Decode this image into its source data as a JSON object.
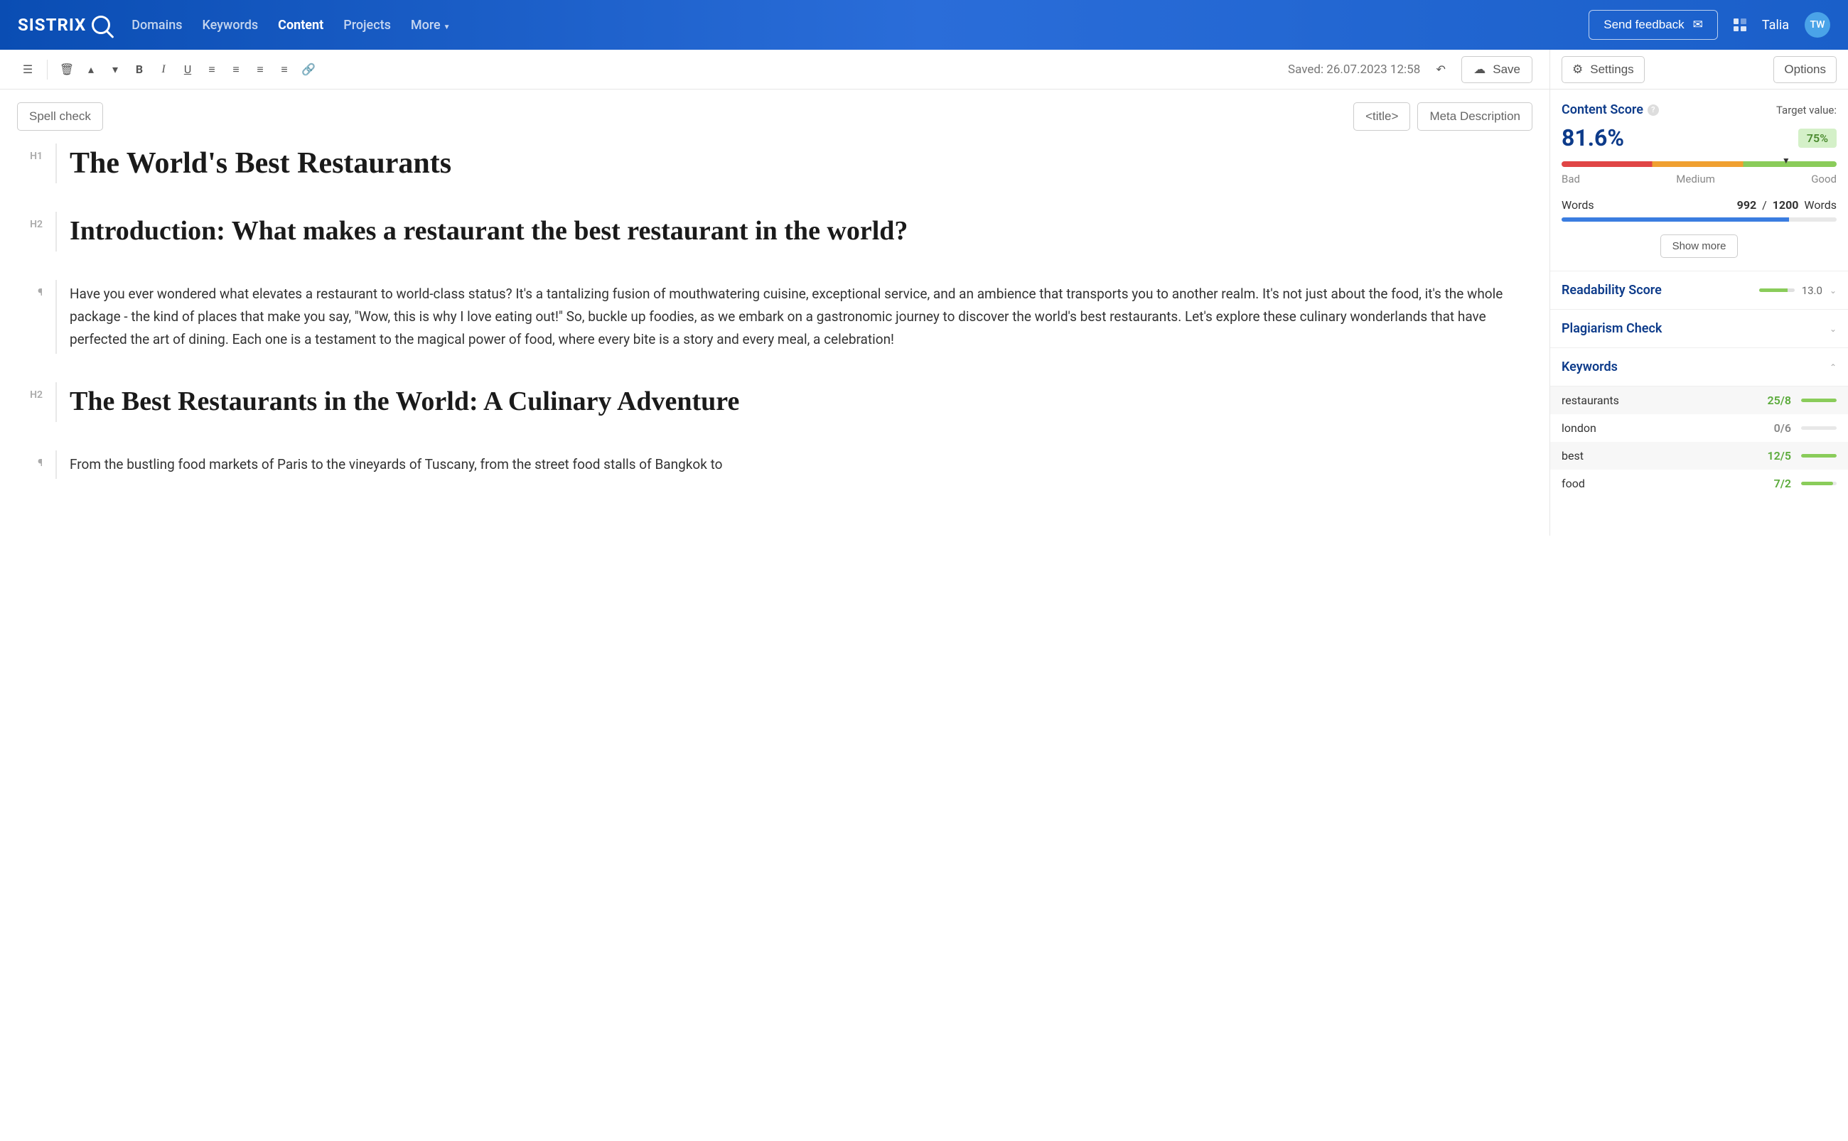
{
  "brand": "SISTRIX",
  "nav": {
    "domains": "Domains",
    "keywords": "Keywords",
    "content": "Content",
    "projects": "Projects",
    "more": "More"
  },
  "feedback_label": "Send feedback",
  "user": {
    "name": "Talia",
    "initials": "TW"
  },
  "toolbar": {
    "saved_prefix": "Saved:",
    "saved_time": "26.07.2023 12:58",
    "save_label": "Save"
  },
  "secbar": {
    "spell": "Spell check",
    "title_btn": "<title>",
    "meta_btn": "Meta Description"
  },
  "blocks": {
    "h1_label": "H1",
    "h2_label": "H2",
    "para_label": "¶",
    "h1_text": "The World's Best Restaurants",
    "h2a_text": "Introduction: What makes a restaurant the best restaurant in the world?",
    "p1_text": "Have you ever wondered what elevates a restaurant to world-class status? It's a tantalizing fusion of mouthwatering cuisine, exceptional service, and an ambience that transports you to another realm. It's not just about the food, it's the whole package - the kind of places that make you say, \"Wow, this is why I love eating out!\" So, buckle up foodies, as we embark on a gastronomic journey to discover the world's best restaurants. Let's explore these culinary wonderlands that have perfected the art of dining. Each one is a testament to the magical power of food, where every bite is a story and every meal, a celebration!",
    "h2b_text": "The Best Restaurants in the World: A Culinary Adventure",
    "p2_text": "From the bustling food markets of Paris to the vineyards of Tuscany, from the street food stalls of Bangkok to"
  },
  "side": {
    "settings_label": "Settings",
    "options_label": "Options",
    "score_title": "Content Score",
    "target_label": "Target value:",
    "score_value": "81.6%",
    "target_value": "75%",
    "bad": "Bad",
    "medium": "Medium",
    "good": "Good",
    "words_label": "Words",
    "words_current": "992",
    "words_sep": "/",
    "words_target": "1200",
    "words_unit": "Words",
    "showmore": "Show more",
    "readability_title": "Readability Score",
    "readability_value": "13.0",
    "plagiarism_title": "Plagiarism Check",
    "keywords_title": "Keywords",
    "keywords": [
      {
        "name": "restaurants",
        "count": "25/8",
        "green": true,
        "fill": 100
      },
      {
        "name": "london",
        "count": "0/6",
        "green": false,
        "fill": 0
      },
      {
        "name": "best",
        "count": "12/5",
        "green": true,
        "fill": 100
      },
      {
        "name": "food",
        "count": "7/2",
        "green": true,
        "fill": 90
      }
    ]
  }
}
